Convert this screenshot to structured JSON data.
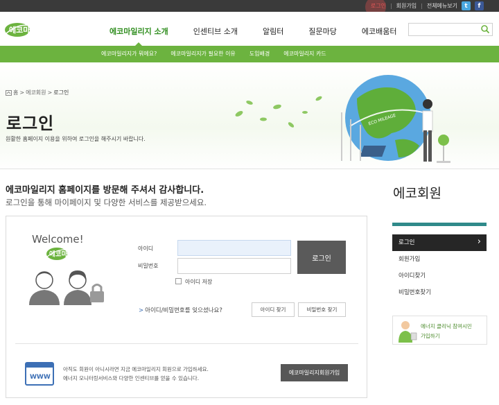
{
  "topbar": {
    "login": "로그인",
    "join": "회원가입",
    "sitemap": "전체메뉴보기",
    "twitter_icon": "twitter-icon",
    "facebook_icon": "facebook-icon"
  },
  "header": {
    "logo_text": "에코마일리지",
    "gnb": [
      "에코마일리지 소개",
      "인센티브 소개",
      "알림터",
      "질문마당",
      "에코배움터"
    ],
    "active_gnb": 0,
    "search": {
      "placeholder": "",
      "icon": "search-icon"
    }
  },
  "subnav": [
    "에코마일리지가 뭐에요?",
    "에코마일리지가 필요한 이유",
    "도입배경",
    "에코마일리지 카드"
  ],
  "breadcrumb": [
    "홈",
    "에코회원",
    "로그인"
  ],
  "page": {
    "title": "로그인",
    "desc": "원활한 홈페이지 이용을 위하여 로그인을 해주시기 바랍니다.",
    "globe_label": "ECO MILEAGE"
  },
  "welcome": {
    "line1": "에코마일리지 홈페이지를 방문해 주셔서 감사합니다.",
    "line2": "로그인을 통해 마이페이지 및 다양한 서비스를 제공받으세요."
  },
  "login": {
    "welcome": "Welcome!",
    "badge": "에코마일리지",
    "id_label": "아이디",
    "pw_label": "비밀번호",
    "id_value": "",
    "pw_value": "",
    "button": "로그인",
    "save_id": "아이디 저장",
    "forgot": "아이디/비밀번호를 잊으셨나요?",
    "find_id": "아이디 찾기",
    "find_pw": "비밀번호 찾기"
  },
  "join": {
    "line1": "아직도 회원이 아니시라면 지금 에코마일리지 회원으로 가입하세요.",
    "line2": "에너지 모니터링서비스와 다양한 인센티브를 얻을 수 있습니다.",
    "button": "에코마일리지회원가입",
    "icon_text": "WWW"
  },
  "sidebar": {
    "title": "에코회원",
    "items": [
      "로그인",
      "회원가입",
      "아이디찾기",
      "비밀번호찾기"
    ],
    "active": 0,
    "banner": {
      "line1": "에너지 클리닉 참여시민",
      "line2": "가입하기"
    }
  },
  "colors": {
    "green": "#6cb33f",
    "dark": "#3a3a3a",
    "active_nav": "#2f8d1e",
    "side_bar": "#2f8a8a"
  }
}
